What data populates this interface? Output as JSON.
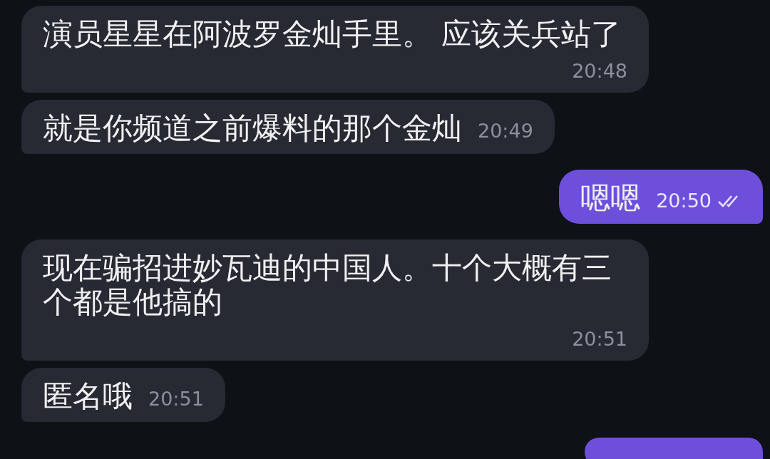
{
  "messages": [
    {
      "kind": "incoming",
      "text": "演员星星在阿波罗金灿手里。 应该关兵站了",
      "time": "20:48"
    },
    {
      "kind": "incoming",
      "text": "就是你频道之前爆料的那个金灿",
      "time": "20:49"
    },
    {
      "kind": "outgoing",
      "text": "嗯嗯",
      "time": "20:50",
      "read": true
    },
    {
      "kind": "incoming",
      "text": "现在骗招进妙瓦迪的中国人。十个大概有三个都是他搞的",
      "time": "20:51"
    },
    {
      "kind": "incoming",
      "text": "匿名哦",
      "time": "20:51"
    },
    {
      "kind": "outgoing"
    }
  ]
}
